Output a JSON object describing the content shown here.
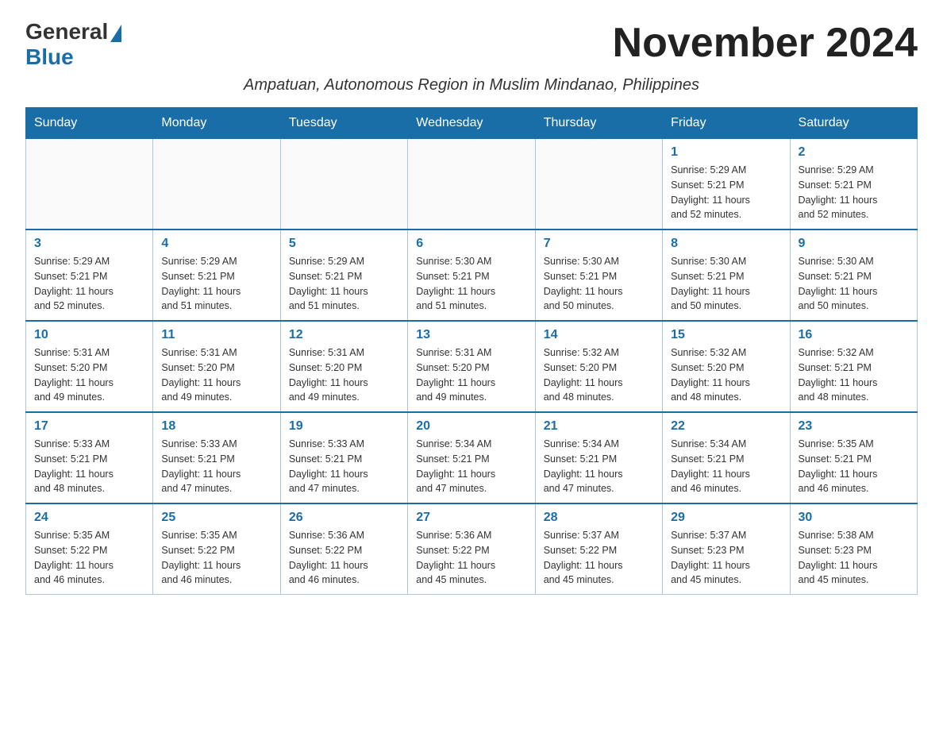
{
  "logo": {
    "general": "General",
    "blue": "Blue"
  },
  "title": "November 2024",
  "subtitle": "Ampatuan, Autonomous Region in Muslim Mindanao, Philippines",
  "days_of_week": [
    "Sunday",
    "Monday",
    "Tuesday",
    "Wednesday",
    "Thursday",
    "Friday",
    "Saturday"
  ],
  "weeks": [
    [
      {
        "day": "",
        "info": ""
      },
      {
        "day": "",
        "info": ""
      },
      {
        "day": "",
        "info": ""
      },
      {
        "day": "",
        "info": ""
      },
      {
        "day": "",
        "info": ""
      },
      {
        "day": "1",
        "info": "Sunrise: 5:29 AM\nSunset: 5:21 PM\nDaylight: 11 hours\nand 52 minutes."
      },
      {
        "day": "2",
        "info": "Sunrise: 5:29 AM\nSunset: 5:21 PM\nDaylight: 11 hours\nand 52 minutes."
      }
    ],
    [
      {
        "day": "3",
        "info": "Sunrise: 5:29 AM\nSunset: 5:21 PM\nDaylight: 11 hours\nand 52 minutes."
      },
      {
        "day": "4",
        "info": "Sunrise: 5:29 AM\nSunset: 5:21 PM\nDaylight: 11 hours\nand 51 minutes."
      },
      {
        "day": "5",
        "info": "Sunrise: 5:29 AM\nSunset: 5:21 PM\nDaylight: 11 hours\nand 51 minutes."
      },
      {
        "day": "6",
        "info": "Sunrise: 5:30 AM\nSunset: 5:21 PM\nDaylight: 11 hours\nand 51 minutes."
      },
      {
        "day": "7",
        "info": "Sunrise: 5:30 AM\nSunset: 5:21 PM\nDaylight: 11 hours\nand 50 minutes."
      },
      {
        "day": "8",
        "info": "Sunrise: 5:30 AM\nSunset: 5:21 PM\nDaylight: 11 hours\nand 50 minutes."
      },
      {
        "day": "9",
        "info": "Sunrise: 5:30 AM\nSunset: 5:21 PM\nDaylight: 11 hours\nand 50 minutes."
      }
    ],
    [
      {
        "day": "10",
        "info": "Sunrise: 5:31 AM\nSunset: 5:20 PM\nDaylight: 11 hours\nand 49 minutes."
      },
      {
        "day": "11",
        "info": "Sunrise: 5:31 AM\nSunset: 5:20 PM\nDaylight: 11 hours\nand 49 minutes."
      },
      {
        "day": "12",
        "info": "Sunrise: 5:31 AM\nSunset: 5:20 PM\nDaylight: 11 hours\nand 49 minutes."
      },
      {
        "day": "13",
        "info": "Sunrise: 5:31 AM\nSunset: 5:20 PM\nDaylight: 11 hours\nand 49 minutes."
      },
      {
        "day": "14",
        "info": "Sunrise: 5:32 AM\nSunset: 5:20 PM\nDaylight: 11 hours\nand 48 minutes."
      },
      {
        "day": "15",
        "info": "Sunrise: 5:32 AM\nSunset: 5:20 PM\nDaylight: 11 hours\nand 48 minutes."
      },
      {
        "day": "16",
        "info": "Sunrise: 5:32 AM\nSunset: 5:21 PM\nDaylight: 11 hours\nand 48 minutes."
      }
    ],
    [
      {
        "day": "17",
        "info": "Sunrise: 5:33 AM\nSunset: 5:21 PM\nDaylight: 11 hours\nand 48 minutes."
      },
      {
        "day": "18",
        "info": "Sunrise: 5:33 AM\nSunset: 5:21 PM\nDaylight: 11 hours\nand 47 minutes."
      },
      {
        "day": "19",
        "info": "Sunrise: 5:33 AM\nSunset: 5:21 PM\nDaylight: 11 hours\nand 47 minutes."
      },
      {
        "day": "20",
        "info": "Sunrise: 5:34 AM\nSunset: 5:21 PM\nDaylight: 11 hours\nand 47 minutes."
      },
      {
        "day": "21",
        "info": "Sunrise: 5:34 AM\nSunset: 5:21 PM\nDaylight: 11 hours\nand 47 minutes."
      },
      {
        "day": "22",
        "info": "Sunrise: 5:34 AM\nSunset: 5:21 PM\nDaylight: 11 hours\nand 46 minutes."
      },
      {
        "day": "23",
        "info": "Sunrise: 5:35 AM\nSunset: 5:21 PM\nDaylight: 11 hours\nand 46 minutes."
      }
    ],
    [
      {
        "day": "24",
        "info": "Sunrise: 5:35 AM\nSunset: 5:22 PM\nDaylight: 11 hours\nand 46 minutes."
      },
      {
        "day": "25",
        "info": "Sunrise: 5:35 AM\nSunset: 5:22 PM\nDaylight: 11 hours\nand 46 minutes."
      },
      {
        "day": "26",
        "info": "Sunrise: 5:36 AM\nSunset: 5:22 PM\nDaylight: 11 hours\nand 46 minutes."
      },
      {
        "day": "27",
        "info": "Sunrise: 5:36 AM\nSunset: 5:22 PM\nDaylight: 11 hours\nand 45 minutes."
      },
      {
        "day": "28",
        "info": "Sunrise: 5:37 AM\nSunset: 5:22 PM\nDaylight: 11 hours\nand 45 minutes."
      },
      {
        "day": "29",
        "info": "Sunrise: 5:37 AM\nSunset: 5:23 PM\nDaylight: 11 hours\nand 45 minutes."
      },
      {
        "day": "30",
        "info": "Sunrise: 5:38 AM\nSunset: 5:23 PM\nDaylight: 11 hours\nand 45 minutes."
      }
    ]
  ]
}
